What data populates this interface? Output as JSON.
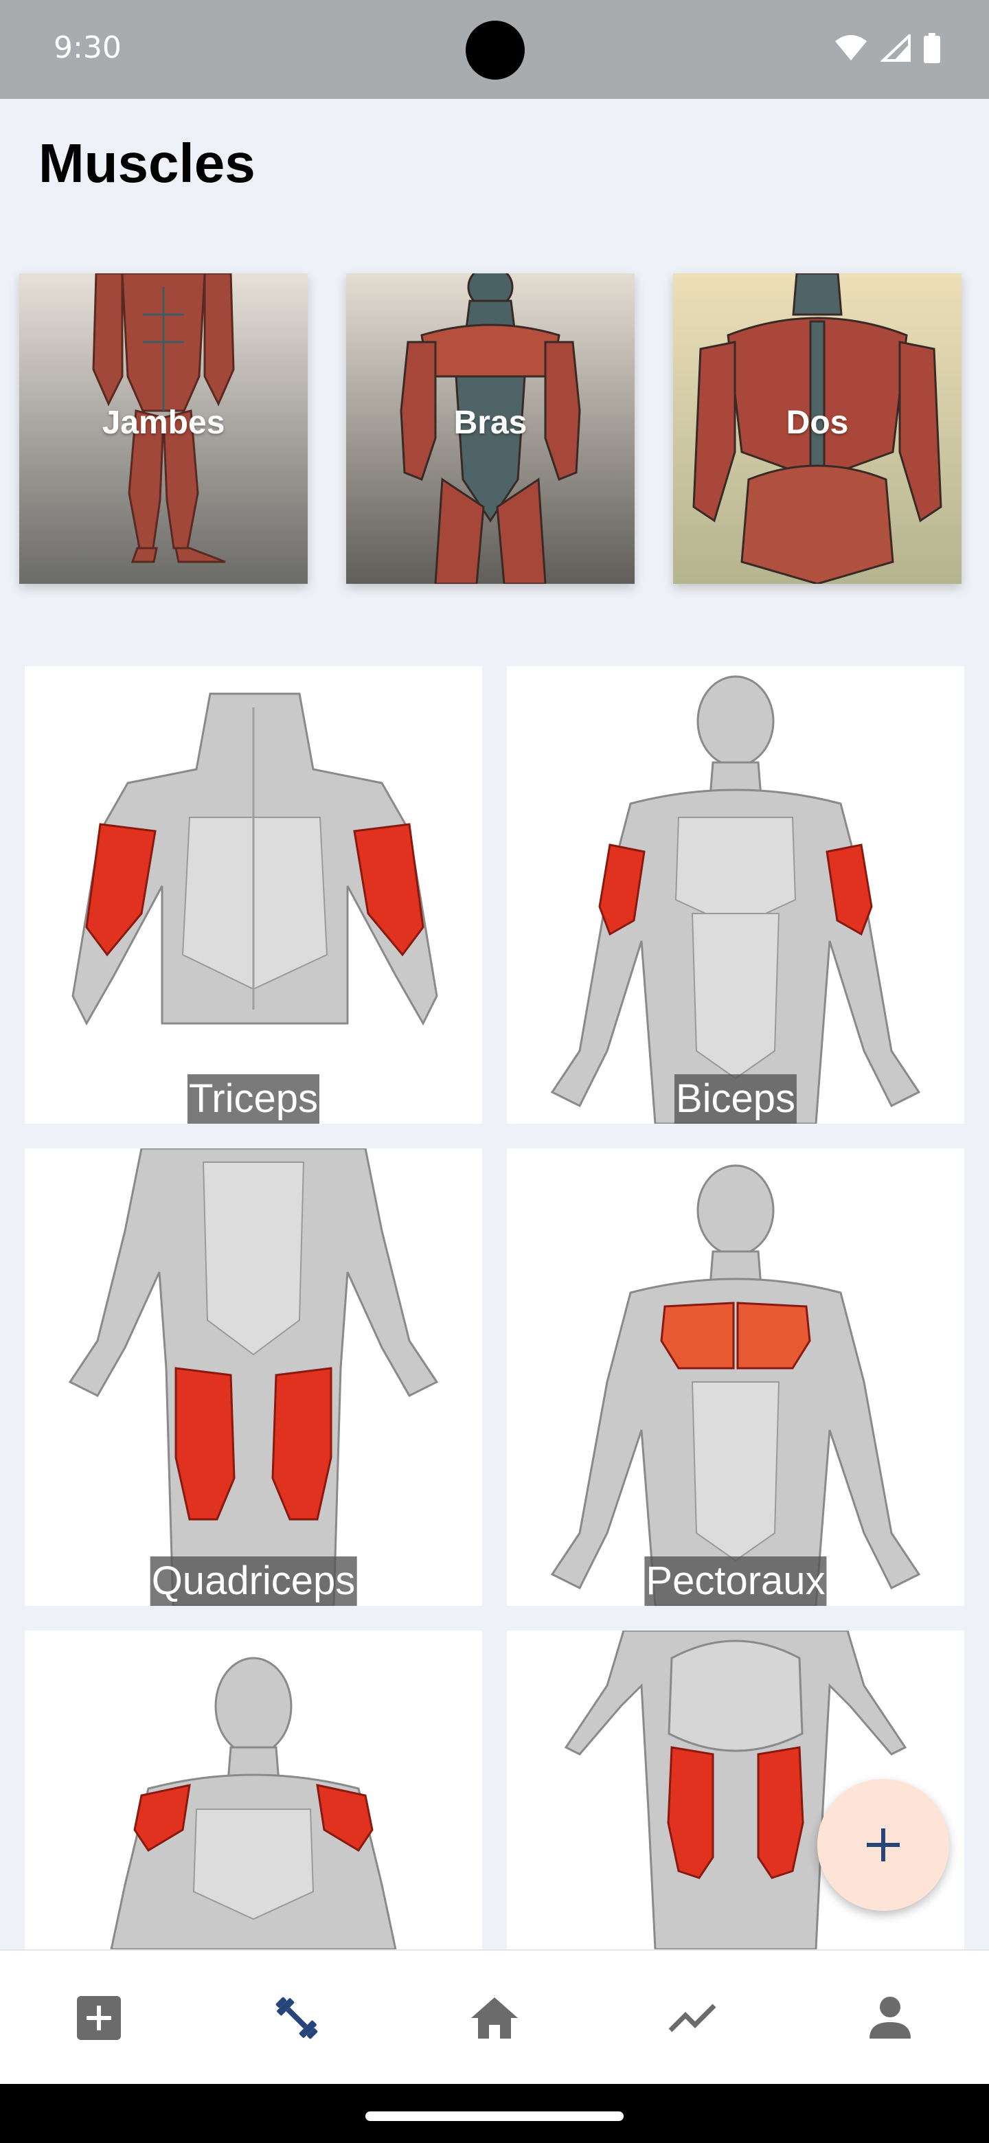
{
  "status_bar": {
    "time": "9:30"
  },
  "page": {
    "title": "Muscles"
  },
  "categories": [
    {
      "label": "Jambes"
    },
    {
      "label": "Bras"
    },
    {
      "label": "Dos"
    }
  ],
  "muscles": [
    {
      "label": "Triceps"
    },
    {
      "label": "Biceps"
    },
    {
      "label": "Quadriceps"
    },
    {
      "label": "Pectoraux"
    }
  ],
  "nav": {
    "items": [
      {
        "icon": "add-box-icon",
        "active": false
      },
      {
        "icon": "dumbbell-icon",
        "active": true
      },
      {
        "icon": "home-icon",
        "active": false
      },
      {
        "icon": "trending-icon",
        "active": false
      },
      {
        "icon": "person-icon",
        "active": false
      }
    ]
  },
  "fab": {
    "icon": "plus-icon"
  },
  "colors": {
    "background": "#eef1f7",
    "accent": "#27457a",
    "nav_icon": "#6b6b6b",
    "fab": "#fde4d6",
    "muscle_highlight": "#e0321e"
  }
}
